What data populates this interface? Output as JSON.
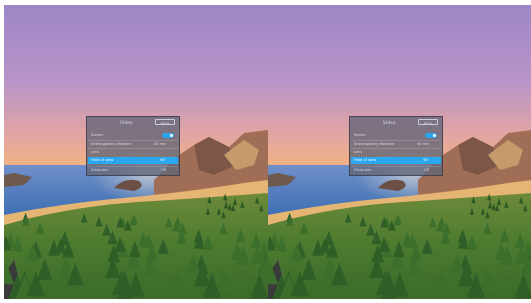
{
  "vr_view": {
    "layout": "side-by-side stereo",
    "eyes": [
      "left",
      "right"
    ]
  },
  "settings_panel": {
    "title": "Video",
    "header_button": "Done",
    "items": [
      {
        "label": "Stereo",
        "control": "toggle",
        "on": true
      },
      {
        "label": "Interpupillary distance",
        "value": "63 mm"
      },
      {
        "label": "Lens",
        "value": ""
      },
      {
        "label": "Field of view",
        "value": "90°",
        "selected": true
      },
      {
        "label": "Distortion",
        "value": "Off"
      }
    ]
  },
  "colors": {
    "sky_top": "#9d86c6",
    "sky_horizon": "#f0b477",
    "sea": "#5b86c4",
    "beach": "#e0b070",
    "grass": "#4f7d34",
    "selection": "#29a7ef"
  }
}
